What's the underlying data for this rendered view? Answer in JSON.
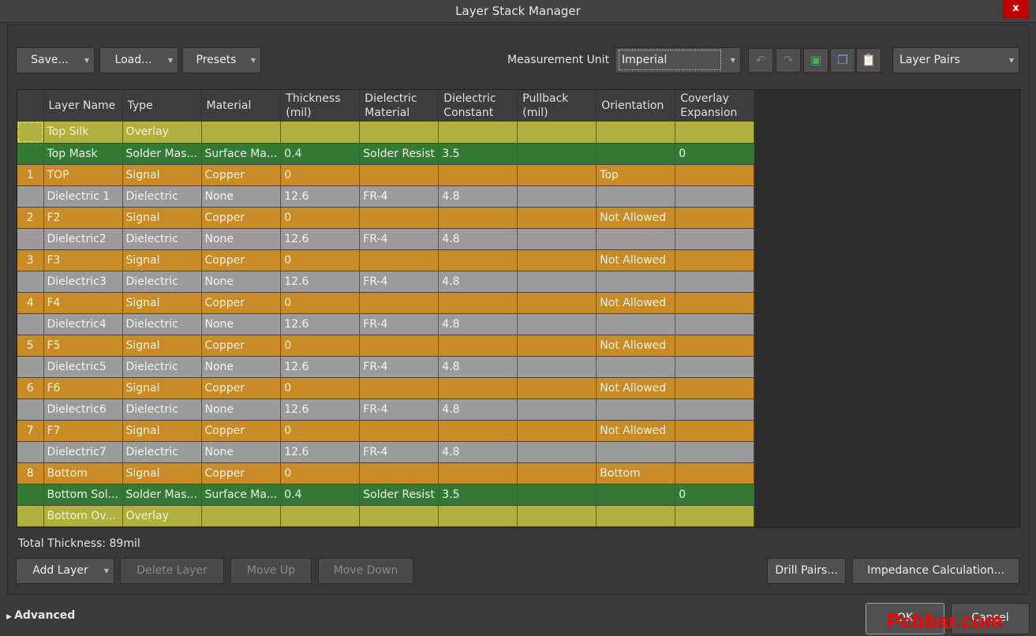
{
  "window": {
    "title": "Layer Stack Manager",
    "close": "x"
  },
  "toolbar": {
    "save": "Save...",
    "load": "Load...",
    "presets": "Presets",
    "measurement_label": "Measurement Unit",
    "measurement_value": "Imperial",
    "view_mode": "Layer Pairs"
  },
  "table": {
    "columns": [
      "",
      "Layer Name",
      "Type",
      "Material",
      "Thickness (mil)",
      "Dielectric Material",
      "Dielectric Constant",
      "Pullback (mil)",
      "Orientation",
      "Coverlay Expansion"
    ],
    "rows": [
      {
        "kind": "Overlay",
        "num": "",
        "name": "Top Silk",
        "type": "Overlay",
        "material": "",
        "thickness": "",
        "diel_mat": "",
        "diel_const": "",
        "pullback": "",
        "orientation": "",
        "coverlay": ""
      },
      {
        "kind": "Mask",
        "num": "",
        "name": "Top Mask",
        "type": "Solder Mas...",
        "material": "Surface Ma...",
        "thickness": "0.4",
        "diel_mat": "Solder Resist",
        "diel_const": "3.5",
        "pullback": "",
        "orientation": "",
        "coverlay": "0"
      },
      {
        "kind": "Signal",
        "num": "1",
        "name": "TOP",
        "type": "Signal",
        "material": "Copper",
        "thickness": "0",
        "diel_mat": "",
        "diel_const": "",
        "pullback": "",
        "orientation": "Top",
        "coverlay": ""
      },
      {
        "kind": "Dielectric",
        "num": "",
        "name": "Dielectric 1",
        "type": "Dielectric",
        "material": "None",
        "thickness": "12.6",
        "diel_mat": "FR-4",
        "diel_const": "4.8",
        "pullback": "",
        "orientation": "",
        "coverlay": ""
      },
      {
        "kind": "Signal",
        "num": "2",
        "name": "F2",
        "type": "Signal",
        "material": "Copper",
        "thickness": "0",
        "diel_mat": "",
        "diel_const": "",
        "pullback": "",
        "orientation": "Not Allowed",
        "coverlay": ""
      },
      {
        "kind": "Dielectric",
        "num": "",
        "name": "Dielectric2",
        "type": "Dielectric",
        "material": "None",
        "thickness": "12.6",
        "diel_mat": "FR-4",
        "diel_const": "4.8",
        "pullback": "",
        "orientation": "",
        "coverlay": ""
      },
      {
        "kind": "Signal",
        "num": "3",
        "name": "F3",
        "type": "Signal",
        "material": "Copper",
        "thickness": "0",
        "diel_mat": "",
        "diel_const": "",
        "pullback": "",
        "orientation": "Not Allowed",
        "coverlay": ""
      },
      {
        "kind": "Dielectric",
        "num": "",
        "name": "Dielectric3",
        "type": "Dielectric",
        "material": "None",
        "thickness": "12.6",
        "diel_mat": "FR-4",
        "diel_const": "4.8",
        "pullback": "",
        "orientation": "",
        "coverlay": ""
      },
      {
        "kind": "Signal",
        "num": "4",
        "name": "F4",
        "type": "Signal",
        "material": "Copper",
        "thickness": "0",
        "diel_mat": "",
        "diel_const": "",
        "pullback": "",
        "orientation": "Not Allowed",
        "coverlay": ""
      },
      {
        "kind": "Dielectric",
        "num": "",
        "name": "Dielectric4",
        "type": "Dielectric",
        "material": "None",
        "thickness": "12.6",
        "diel_mat": "FR-4",
        "diel_const": "4.8",
        "pullback": "",
        "orientation": "",
        "coverlay": ""
      },
      {
        "kind": "Signal",
        "num": "5",
        "name": "F5",
        "type": "Signal",
        "material": "Copper",
        "thickness": "0",
        "diel_mat": "",
        "diel_const": "",
        "pullback": "",
        "orientation": "Not Allowed",
        "coverlay": ""
      },
      {
        "kind": "Dielectric",
        "num": "",
        "name": "Dielectric5",
        "type": "Dielectric",
        "material": "None",
        "thickness": "12.6",
        "diel_mat": "FR-4",
        "diel_const": "4.8",
        "pullback": "",
        "orientation": "",
        "coverlay": ""
      },
      {
        "kind": "Signal",
        "num": "6",
        "name": "F6",
        "type": "Signal",
        "material": "Copper",
        "thickness": "0",
        "diel_mat": "",
        "diel_const": "",
        "pullback": "",
        "orientation": "Not Allowed",
        "coverlay": ""
      },
      {
        "kind": "Dielectric",
        "num": "",
        "name": "Dielectric6",
        "type": "Dielectric",
        "material": "None",
        "thickness": "12.6",
        "diel_mat": "FR-4",
        "diel_const": "4.8",
        "pullback": "",
        "orientation": "",
        "coverlay": ""
      },
      {
        "kind": "Signal",
        "num": "7",
        "name": "F7",
        "type": "Signal",
        "material": "Copper",
        "thickness": "0",
        "diel_mat": "",
        "diel_const": "",
        "pullback": "",
        "orientation": "Not Allowed",
        "coverlay": ""
      },
      {
        "kind": "Dielectric",
        "num": "",
        "name": "Dielectric7",
        "type": "Dielectric",
        "material": "None",
        "thickness": "12.6",
        "diel_mat": "FR-4",
        "diel_const": "4.8",
        "pullback": "",
        "orientation": "",
        "coverlay": ""
      },
      {
        "kind": "Signal",
        "num": "8",
        "name": "Bottom",
        "type": "Signal",
        "material": "Copper",
        "thickness": "0",
        "diel_mat": "",
        "diel_const": "",
        "pullback": "",
        "orientation": "Bottom",
        "coverlay": ""
      },
      {
        "kind": "Mask",
        "num": "",
        "name": "Bottom Sol...",
        "type": "Solder Mas...",
        "material": "Surface Ma...",
        "thickness": "0.4",
        "diel_mat": "Solder Resist",
        "diel_const": "3.5",
        "pullback": "",
        "orientation": "",
        "coverlay": "0"
      },
      {
        "kind": "Overlay",
        "num": "",
        "name": "Bottom Ov...",
        "type": "Overlay",
        "material": "",
        "thickness": "",
        "diel_mat": "",
        "diel_const": "",
        "pullback": "",
        "orientation": "",
        "coverlay": ""
      }
    ]
  },
  "footer": {
    "total_thickness": "Total Thickness: 89mil",
    "add_layer": "Add Layer",
    "delete_layer": "Delete Layer",
    "move_up": "Move Up",
    "move_down": "Move Down",
    "drill_pairs": "Drill Pairs...",
    "impedance": "Impedance Calculation...",
    "advanced": "Advanced",
    "ok": "OK",
    "cancel": "Cancel"
  },
  "watermark": "Pcbbar.com"
}
